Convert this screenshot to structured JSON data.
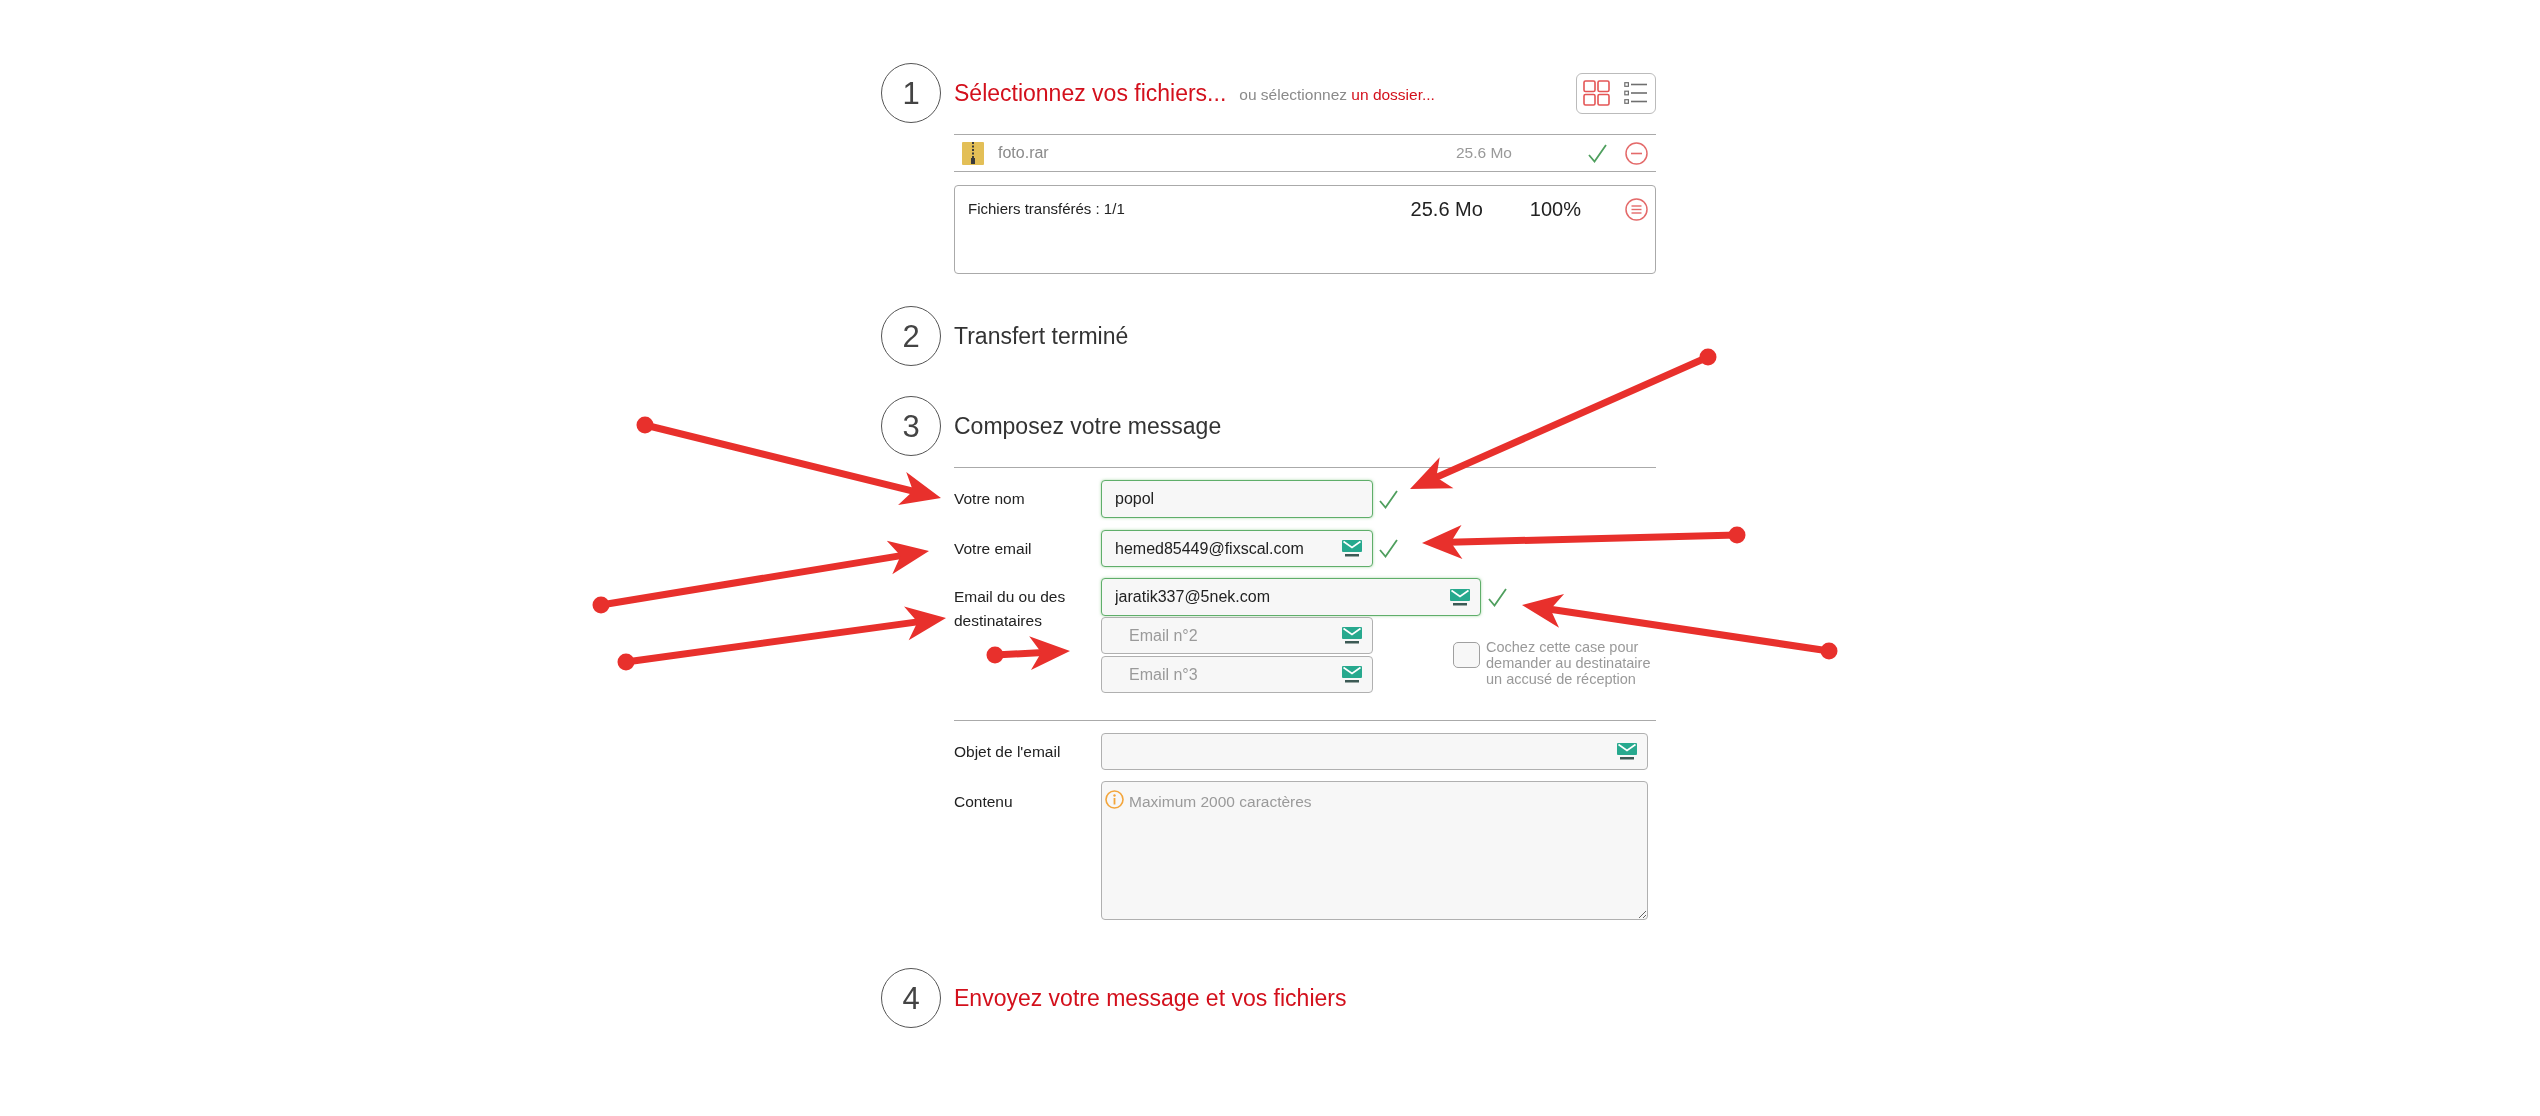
{
  "steps": [
    {
      "number": "1",
      "title": "Sélectionnez vos fichiers...",
      "highlighted": true,
      "kind": "files",
      "alt_text": "ou sélectionnez",
      "alt_link": "un dossier...",
      "views": [
        {
          "kind": "grid",
          "selected": true
        },
        {
          "kind": "list",
          "selected": false
        }
      ],
      "files": [
        {
          "name": "foto.rar",
          "size": "25.6 Mo",
          "done": true
        }
      ],
      "summary": {
        "label": "Fichiers transférés : 1/1",
        "size": "25.6 Mo",
        "percent": "100%"
      }
    },
    {
      "number": "2",
      "title": "Transfert terminé",
      "highlighted": false,
      "kind": "status"
    },
    {
      "number": "3",
      "title": "Composez votre message",
      "highlighted": false,
      "kind": "form",
      "fields": [
        {
          "kind": "name",
          "label": "Votre nom",
          "inputs": [
            {
              "value": "popol",
              "valid": true
            }
          ]
        },
        {
          "kind": "email",
          "label": "Votre email",
          "inputs": [
            {
              "value": "hemed85449@fixscal.com",
              "valid": true
            }
          ]
        },
        {
          "kind": "recipients",
          "label": "Email du ou des destinataires",
          "inputs": [
            {
              "value": "jaratik337@5nek.com",
              "valid": true
            },
            {
              "placeholder": "Email n°2",
              "valid": false
            },
            {
              "placeholder": "Email n°3",
              "valid": false
            }
          ],
          "receipt": {
            "label": "Cochez cette case pour demander au destinataire un accusé de réception",
            "checked": false
          }
        }
      ],
      "details": [
        {
          "kind": "subject",
          "label": "Objet de l'email"
        },
        {
          "kind": "body",
          "label": "Contenu",
          "placeholder": "Maximum 2000 caractères"
        }
      ]
    },
    {
      "number": "4",
      "title": "Envoyez votre message et vos fichiers",
      "highlighted": true,
      "kind": "send"
    }
  ]
}
